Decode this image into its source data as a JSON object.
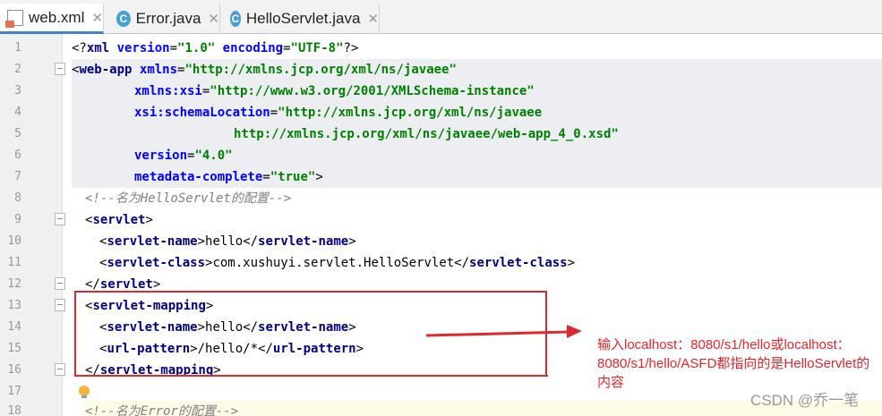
{
  "tabs": [
    {
      "label": "web.xml",
      "icon": "xml-file-icon",
      "active": true
    },
    {
      "label": "Error.java",
      "icon": "java-class-icon",
      "active": false
    },
    {
      "label": "HelloServlet.java",
      "icon": "java-class-icon",
      "active": false
    }
  ],
  "editor": {
    "lines": [
      {
        "n": "1",
        "text": "<?xml version=\"1.0\" encoding=\"UTF-8\"?>"
      },
      {
        "n": "2",
        "text": "<web-app xmlns=\"http://xmlns.jcp.org/xml/ns/javaee\""
      },
      {
        "n": "3",
        "text": "xmlns:xsi=\"http://www.w3.org/2001/XMLSchema-instance\""
      },
      {
        "n": "4",
        "text": "xsi:schemaLocation=\"http://xmlns.jcp.org/xml/ns/javaee"
      },
      {
        "n": "5",
        "text": "http://xmlns.jcp.org/xml/ns/javaee/web-app_4_0.xsd\""
      },
      {
        "n": "6",
        "text": "version=\"4.0\""
      },
      {
        "n": "7",
        "text": "metadata-complete=\"true\">"
      },
      {
        "n": "8",
        "text": "<!--名为HelloServlet的配置-->"
      },
      {
        "n": "9",
        "text": "<servlet>"
      },
      {
        "n": "10",
        "text": "<servlet-name>hello</servlet-name>"
      },
      {
        "n": "11",
        "text": "<servlet-class>com.xushuyi.servlet.HelloServlet</servlet-class>"
      },
      {
        "n": "12",
        "text": "</servlet>"
      },
      {
        "n": "13",
        "text": "<servlet-mapping>"
      },
      {
        "n": "14",
        "text": "<servlet-name>hello</servlet-name>"
      },
      {
        "n": "15",
        "text": "<url-pattern>/hello/*</url-pattern>"
      },
      {
        "n": "16",
        "text": "</servlet-mapping>"
      },
      {
        "n": "17",
        "text": ""
      },
      {
        "n": "18",
        "text": "<!--名为Error的配置-->"
      }
    ],
    "tokens": {
      "l1": [
        "<?",
        "xml",
        " ",
        "version",
        "=",
        "\"1.0\"",
        " ",
        "encoding",
        "=",
        "\"UTF-8\"",
        "?>"
      ],
      "l2": [
        "<",
        "web-app",
        " ",
        "xmlns",
        "=",
        "\"http://xmlns.jcp.org/xml/ns/javaee\""
      ],
      "l3": [
        "xmlns:xsi",
        "=",
        "\"http://www.w3.org/2001/XMLSchema-instance\""
      ],
      "l4": [
        "xsi:schemaLocation",
        "=",
        "\"http://xmlns.jcp.org/xml/ns/javaee"
      ],
      "l5": [
        "http://xmlns.jcp.org/xml/ns/javaee/web-app_4_0.xsd\""
      ],
      "l6": [
        "version",
        "=",
        "\"4.0\""
      ],
      "l7": [
        "metadata-complete",
        "=",
        "\"true\"",
        ">"
      ],
      "l8": [
        "<!--名为HelloServlet的配置-->"
      ],
      "l9": [
        "<",
        "servlet",
        ">"
      ],
      "l10": [
        "<",
        "servlet-name",
        ">",
        "hello",
        "</",
        "servlet-name",
        ">"
      ],
      "l11": [
        "<",
        "servlet-class",
        ">",
        "com.xushuyi.servlet.HelloServlet",
        "</",
        "servlet-class",
        ">"
      ],
      "l12": [
        "</",
        "servlet",
        ">"
      ],
      "l13": [
        "<",
        "servlet-mapping",
        ">"
      ],
      "l14": [
        "<",
        "servlet-name",
        ">",
        "hello",
        "</",
        "servlet-name",
        ">"
      ],
      "l15": [
        "<",
        "url-pattern",
        ">",
        "/hello/*",
        "</",
        "url-pattern",
        ">"
      ],
      "l16": [
        "</",
        "servlet-mapping",
        ">"
      ],
      "l18": [
        "<!--名为Error的配置-->"
      ]
    }
  },
  "annotation": {
    "note": "输入localhost：8080/s1/hello或localhost：8080/s1/hello/ASFD都指向的是HelloServlet的内容",
    "color": "#e8252c"
  },
  "watermark": "CSDN @乔一笔",
  "colors": {
    "tag": "#000080",
    "attr": "#0000ff",
    "value": "#008000",
    "comment": "#808080"
  }
}
